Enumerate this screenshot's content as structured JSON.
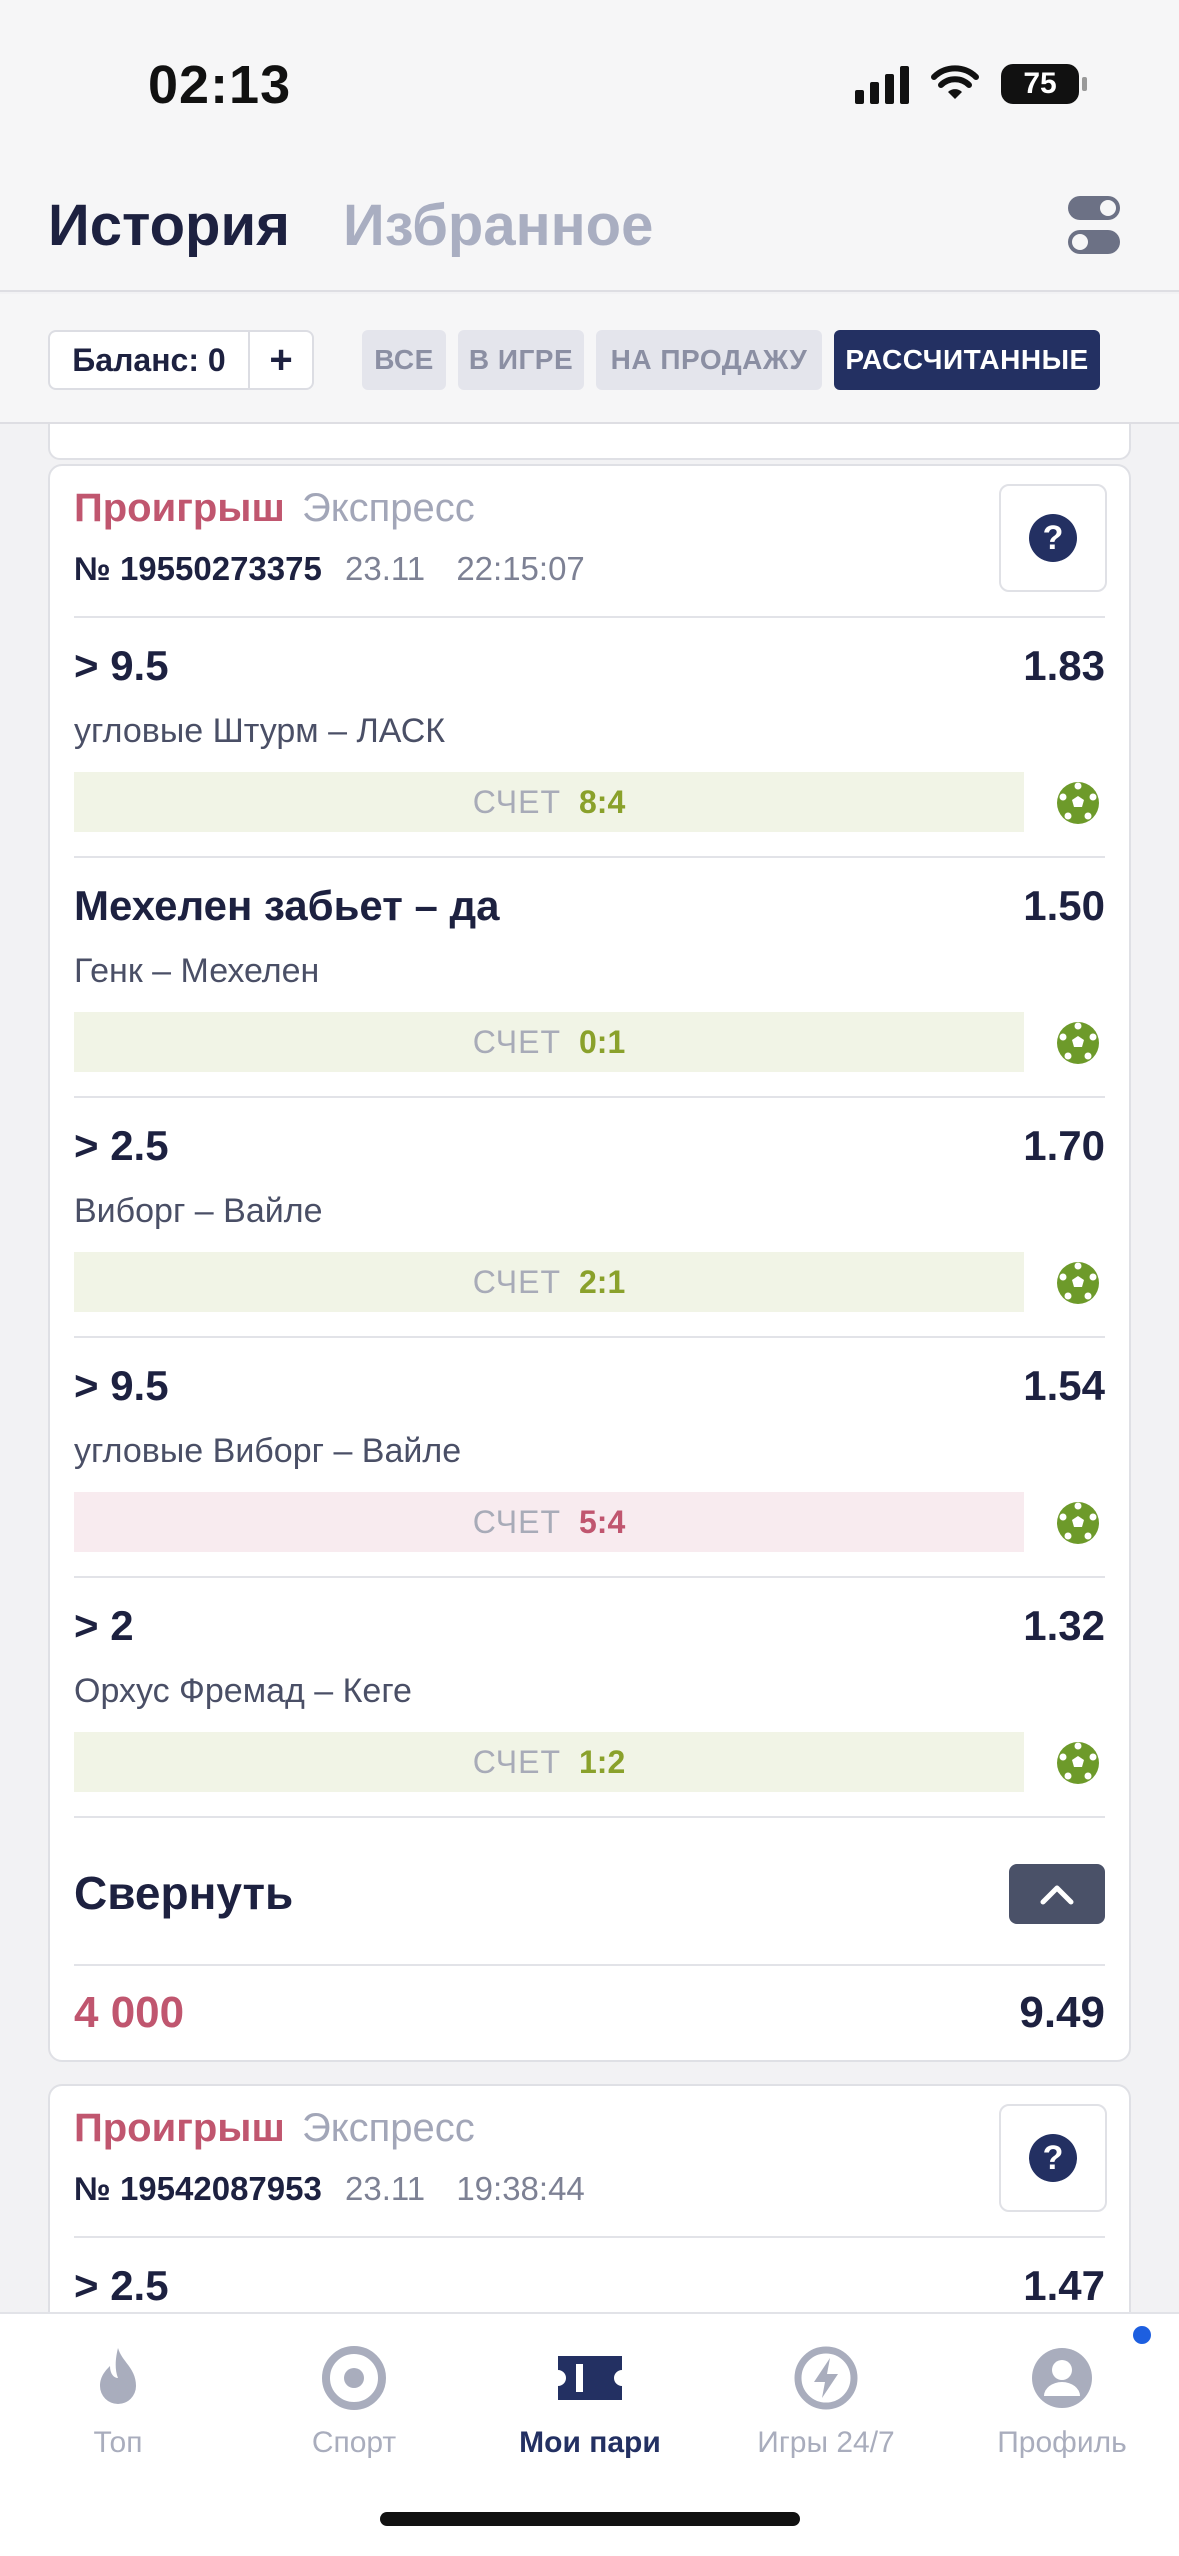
{
  "status_bar": {
    "time": "02:13",
    "battery": "75"
  },
  "header": {
    "tab_history": "История",
    "tab_favorites": "Избранное"
  },
  "filters": {
    "balance_label": "Баланс: 0",
    "add_label": "+",
    "chips": [
      "ВСЕ",
      "В ИГРЕ",
      "НА ПРОДАЖУ",
      "РАССЧИТАННЫЕ"
    ],
    "active_chip": "РАССЧИТАННЫЕ"
  },
  "cards": [
    {
      "status": "Проигрыш",
      "type": "Экспресс",
      "number": "№ 19550273375",
      "date": "23.11",
      "time": "22:15:07",
      "help": "?",
      "bets": [
        {
          "name": "> 9.5",
          "odd": "1.83",
          "match": "угловые Штурм – ЛАСК",
          "score_label": "СЧЕТ",
          "score": "8:4",
          "result": "won"
        },
        {
          "name": "Мехелен забьет – да",
          "odd": "1.50",
          "match": "Генк – Мехелен",
          "score_label": "СЧЕТ",
          "score": "0:1",
          "result": "won"
        },
        {
          "name": "> 2.5",
          "odd": "1.70",
          "match": "Виборг – Вайле",
          "score_label": "СЧЕТ",
          "score": "2:1",
          "result": "won"
        },
        {
          "name": "> 9.5",
          "odd": "1.54",
          "match": "угловые Виборг – Вайле",
          "score_label": "СЧЕТ",
          "score": "5:4",
          "result": "lost"
        },
        {
          "name": "> 2",
          "odd": "1.32",
          "match": "Орхус Фремад – Кеге",
          "score_label": "СЧЕТ",
          "score": "1:2",
          "result": "won"
        }
      ],
      "collapse_label": "Свернуть",
      "stake": "4 000",
      "total_odd": "9.49"
    },
    {
      "status": "Проигрыш",
      "type": "Экспресс",
      "number": "№ 19542087953",
      "date": "23.11",
      "time": "19:38:44",
      "help": "?",
      "bets": [
        {
          "name": "> 2.5",
          "odd": "1.47"
        }
      ]
    }
  ],
  "bottom_nav": [
    {
      "label": "Топ",
      "icon": "flame-icon"
    },
    {
      "label": "Спорт",
      "icon": "target-icon"
    },
    {
      "label": "Мои пари",
      "icon": "ticket-icon",
      "active": true
    },
    {
      "label": "Игры 24/7",
      "icon": "lightning-icon"
    },
    {
      "label": "Профиль",
      "icon": "user-icon"
    }
  ],
  "colors": {
    "primary": "#233062",
    "lost": "#c0566f",
    "won": "#8aa12b",
    "ball": "#6d9a2a"
  }
}
